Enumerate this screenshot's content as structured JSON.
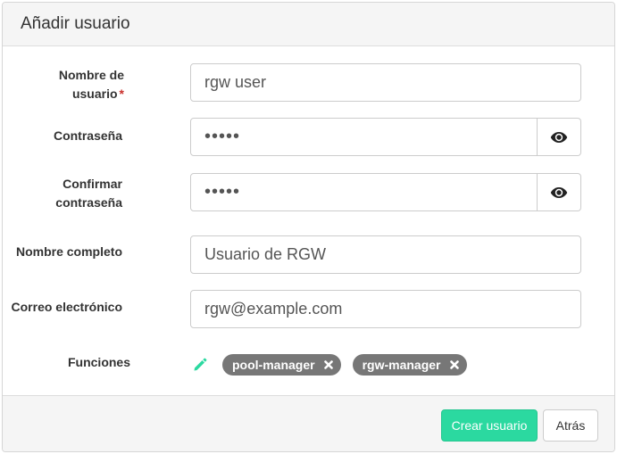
{
  "dialog": {
    "title": "Añadir usuario"
  },
  "form": {
    "username": {
      "label_line1": "Nombre de",
      "label_line2": "usuario",
      "required_marker": "*",
      "value": "rgw user"
    },
    "password": {
      "label": "Contraseña",
      "value": "•••••"
    },
    "confirm_password": {
      "label_line1": "Confirmar",
      "label_line2": "contraseña",
      "value": "•••••"
    },
    "full_name": {
      "label": "Nombre completo",
      "value": "Usuario de RGW"
    },
    "email": {
      "label": "Correo electrónico",
      "value": "rgw@example.com"
    },
    "roles": {
      "label": "Funciones",
      "items": [
        {
          "label": "pool-manager"
        },
        {
          "label": "rgw-manager"
        }
      ]
    }
  },
  "footer": {
    "create_label": "Crear usuario",
    "back_label": "Atrás"
  },
  "colors": {
    "primary": "#2bd9a0",
    "badge": "#777777",
    "required": "#c9302c",
    "pencil": "#2bd9a0"
  },
  "icons": {
    "show_password": "eye-icon",
    "edit_roles": "pencil-icon",
    "remove_role": "close-icon"
  }
}
